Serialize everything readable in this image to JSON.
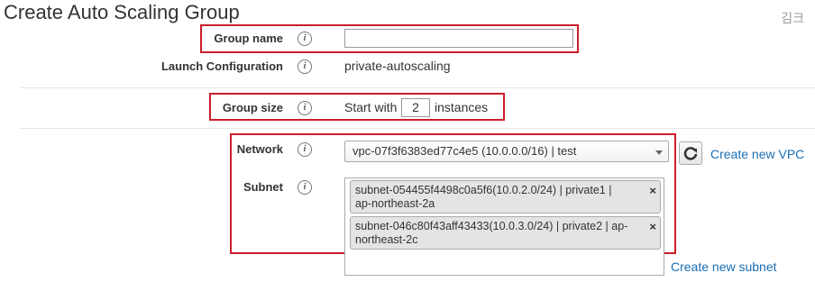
{
  "header": {
    "title": "Create Auto Scaling Group",
    "corner_text": "김크"
  },
  "group_name": {
    "label": "Group name",
    "value": "",
    "placeholder": ""
  },
  "launch_configuration": {
    "label": "Launch Configuration",
    "value": "private-autoscaling"
  },
  "group_size": {
    "label": "Group size",
    "prefix": "Start with",
    "value": "2",
    "suffix": "instances"
  },
  "network": {
    "label": "Network",
    "selected": "vpc-07f3f6383ed77c4e5 (10.0.0.0/16) | test",
    "create_link": "Create new VPC"
  },
  "subnet": {
    "label": "Subnet",
    "items": [
      {
        "line1": "subnet-054455f4498c0a5f6(10.0.2.0/24) | private1 |",
        "line2": "ap-northeast-2a",
        "remove": "×"
      },
      {
        "line1": "subnet-046c80f43aff43433(10.0.3.0/24) | private2 | ap-",
        "line2": "northeast-2c",
        "remove": "×"
      }
    ],
    "create_link": "Create new subnet"
  },
  "info_glyph": "i",
  "colors": {
    "highlight": "#cc1f2b",
    "link": "#1a6fb5"
  }
}
